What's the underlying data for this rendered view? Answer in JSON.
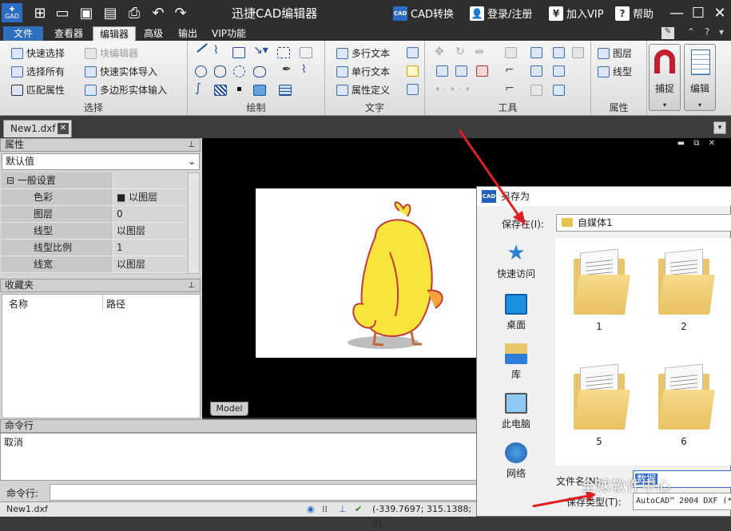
{
  "titlebar": {
    "title": "迅捷CAD编辑器",
    "cad_convert": "CAD转换",
    "login": "登录/注册",
    "vip": "加入VIP",
    "help": "帮助",
    "logo_text": "GAD"
  },
  "menu": [
    "文件",
    "查看器",
    "编辑器",
    "高级",
    "输出",
    "VIP功能"
  ],
  "ribbon": {
    "select": {
      "label": "选择",
      "quick_select": "快速选择",
      "block_editor": "块编辑器",
      "select_all": "选择所有",
      "quick_entity_import": "快速实体导入",
      "match_props": "匹配属性",
      "polygon_entity_input": "多边形实体输入"
    },
    "draw": {
      "label": "绘制"
    },
    "text": {
      "label": "文字",
      "mtext": "多行文本",
      "stext": "单行文本",
      "attdef": "属性定义"
    },
    "tools": {
      "label": "工具"
    },
    "props": {
      "label": "属性",
      "layer": "图层",
      "linetype": "线型"
    },
    "snap": "捕捉",
    "edit": "编辑"
  },
  "doc_tab": "New1.dxf",
  "props_panel": {
    "title": "属性",
    "combo": "默认值",
    "rows": [
      {
        "k": "一般设置",
        "v": ""
      },
      {
        "k": "色彩",
        "v": "■ 以图层"
      },
      {
        "k": "图层",
        "v": "0"
      },
      {
        "k": "线型",
        "v": "以图层"
      },
      {
        "k": "线型比例",
        "v": "1"
      },
      {
        "k": "线宽",
        "v": "以图层"
      }
    ]
  },
  "fav_panel": {
    "title": "收藏夹",
    "col_name": "名称",
    "col_path": "路径"
  },
  "canvas": {
    "model_tab": "Model"
  },
  "command": {
    "title": "命令行",
    "output": "取消",
    "input_label": "命令行:"
  },
  "status": {
    "file": "New1.dxf",
    "coords": "(-339.7697; 315.1388; 0)"
  },
  "dialog": {
    "title": "另存为",
    "save_in_label": "保存在(I):",
    "save_in_value": "自媒体1",
    "side": [
      "快速访问",
      "桌面",
      "库",
      "此电脑",
      "网络"
    ],
    "files": [
      "1",
      "2",
      "5",
      "6"
    ],
    "name_label": "文件名(N):",
    "name_value": "数据",
    "type_label": "保存类型(T):",
    "type_value": "AutoCAD™ 2004 DXF (*"
  },
  "watermark": "全球软件中心",
  "colors": {
    "accent": "#2f6fbd",
    "title_bg": "#2e2e2e",
    "canvas_bg": "#000000",
    "duck_yellow": "#f7e53b"
  }
}
